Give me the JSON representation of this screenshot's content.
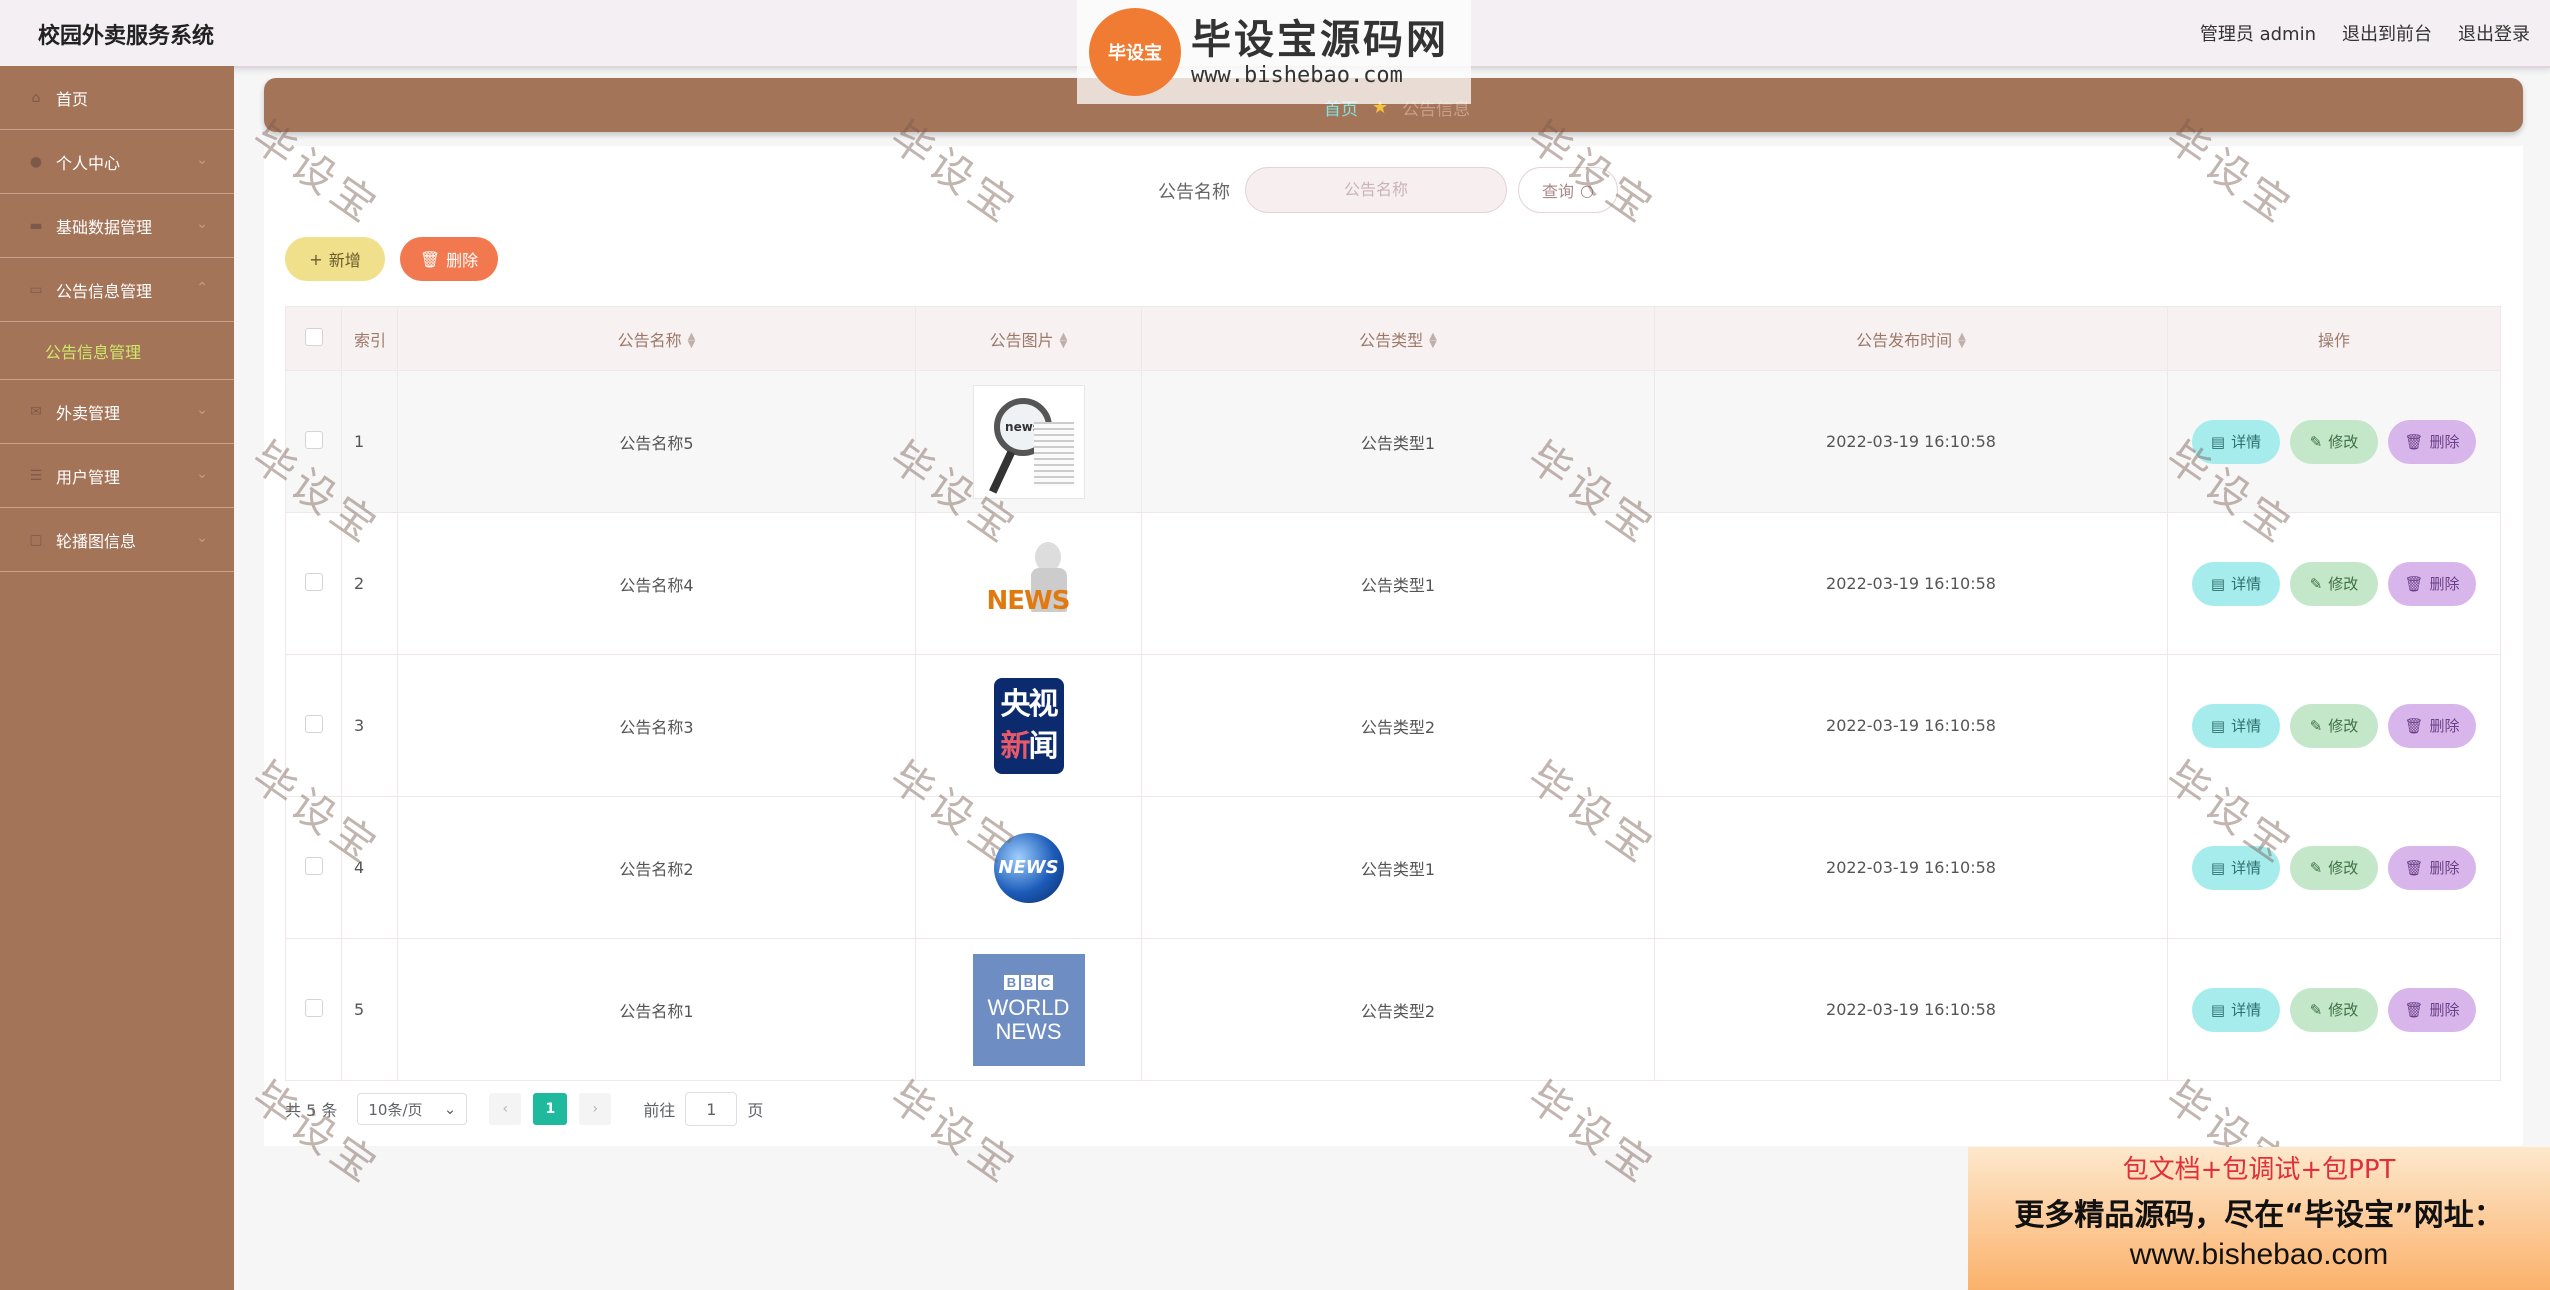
{
  "header": {
    "title": "校园外卖服务系统",
    "user": "管理员 admin",
    "to_front": "退出到前台",
    "logout": "退出登录"
  },
  "sidebar": {
    "items": [
      {
        "label": "首页",
        "icon": "home-icon"
      },
      {
        "label": "个人中心",
        "icon": "user-icon"
      },
      {
        "label": "基础数据管理",
        "icon": "data-icon"
      },
      {
        "label": "公告信息管理",
        "icon": "monitor-icon"
      },
      {
        "label": "外卖管理",
        "icon": "mail-icon"
      },
      {
        "label": "用户管理",
        "icon": "list-icon"
      },
      {
        "label": "轮播图信息",
        "icon": "image-icon"
      }
    ],
    "sub_active": "公告信息管理"
  },
  "breadcrumb": {
    "home": "首页",
    "current": "公告信息"
  },
  "search": {
    "label": "公告名称",
    "placeholder": "公告名称",
    "button": "查询"
  },
  "actions": {
    "add": "新增",
    "delete": "删除"
  },
  "table": {
    "headers": [
      "索引",
      "公告名称",
      "公告图片",
      "公告类型",
      "公告发布时间",
      "操作"
    ],
    "rows": [
      {
        "index": "1",
        "name": "公告名称5",
        "type": "公告类型1",
        "time": "2022-03-19 16:10:58"
      },
      {
        "index": "2",
        "name": "公告名称4",
        "type": "公告类型1",
        "time": "2022-03-19 16:10:58"
      },
      {
        "index": "3",
        "name": "公告名称3",
        "type": "公告类型2",
        "time": "2022-03-19 16:10:58"
      },
      {
        "index": "4",
        "name": "公告名称2",
        "type": "公告类型1",
        "time": "2022-03-19 16:10:58"
      },
      {
        "index": "5",
        "name": "公告名称1",
        "type": "公告类型2",
        "time": "2022-03-19 16:10:58"
      }
    ],
    "op_detail": "详情",
    "op_edit": "修改",
    "op_delete": "删除"
  },
  "images": {
    "img1_text": "news",
    "img2_text": "NEWS",
    "img3_chars": [
      "央",
      "视",
      "新",
      "闻"
    ],
    "img4_text": "NEWS",
    "img5_letters": [
      "B",
      "B",
      "C"
    ],
    "img5_line1": "WORLD",
    "img5_line2": "NEWS"
  },
  "pagination": {
    "total": "共 5 条",
    "page_size": "10条/页",
    "current": "1",
    "goto_label": "前往",
    "goto_value": "1",
    "page_suffix": "页"
  },
  "watermark": {
    "logo_badge": "毕设宝",
    "logo_title": "毕设宝源码网",
    "logo_url": "www.bishebao.com",
    "tile": "毕设宝"
  },
  "ad": {
    "line1": "包文档+包调试+包PPT",
    "line2": "更多精品源码，尽在“毕设宝”网址：",
    "line3": "www.bishebao.com"
  },
  "colors": {
    "sidebar": "#a47459",
    "accent_green": "#1fb99e",
    "add_button": "#f0e08c",
    "delete_button": "#f2794f"
  }
}
